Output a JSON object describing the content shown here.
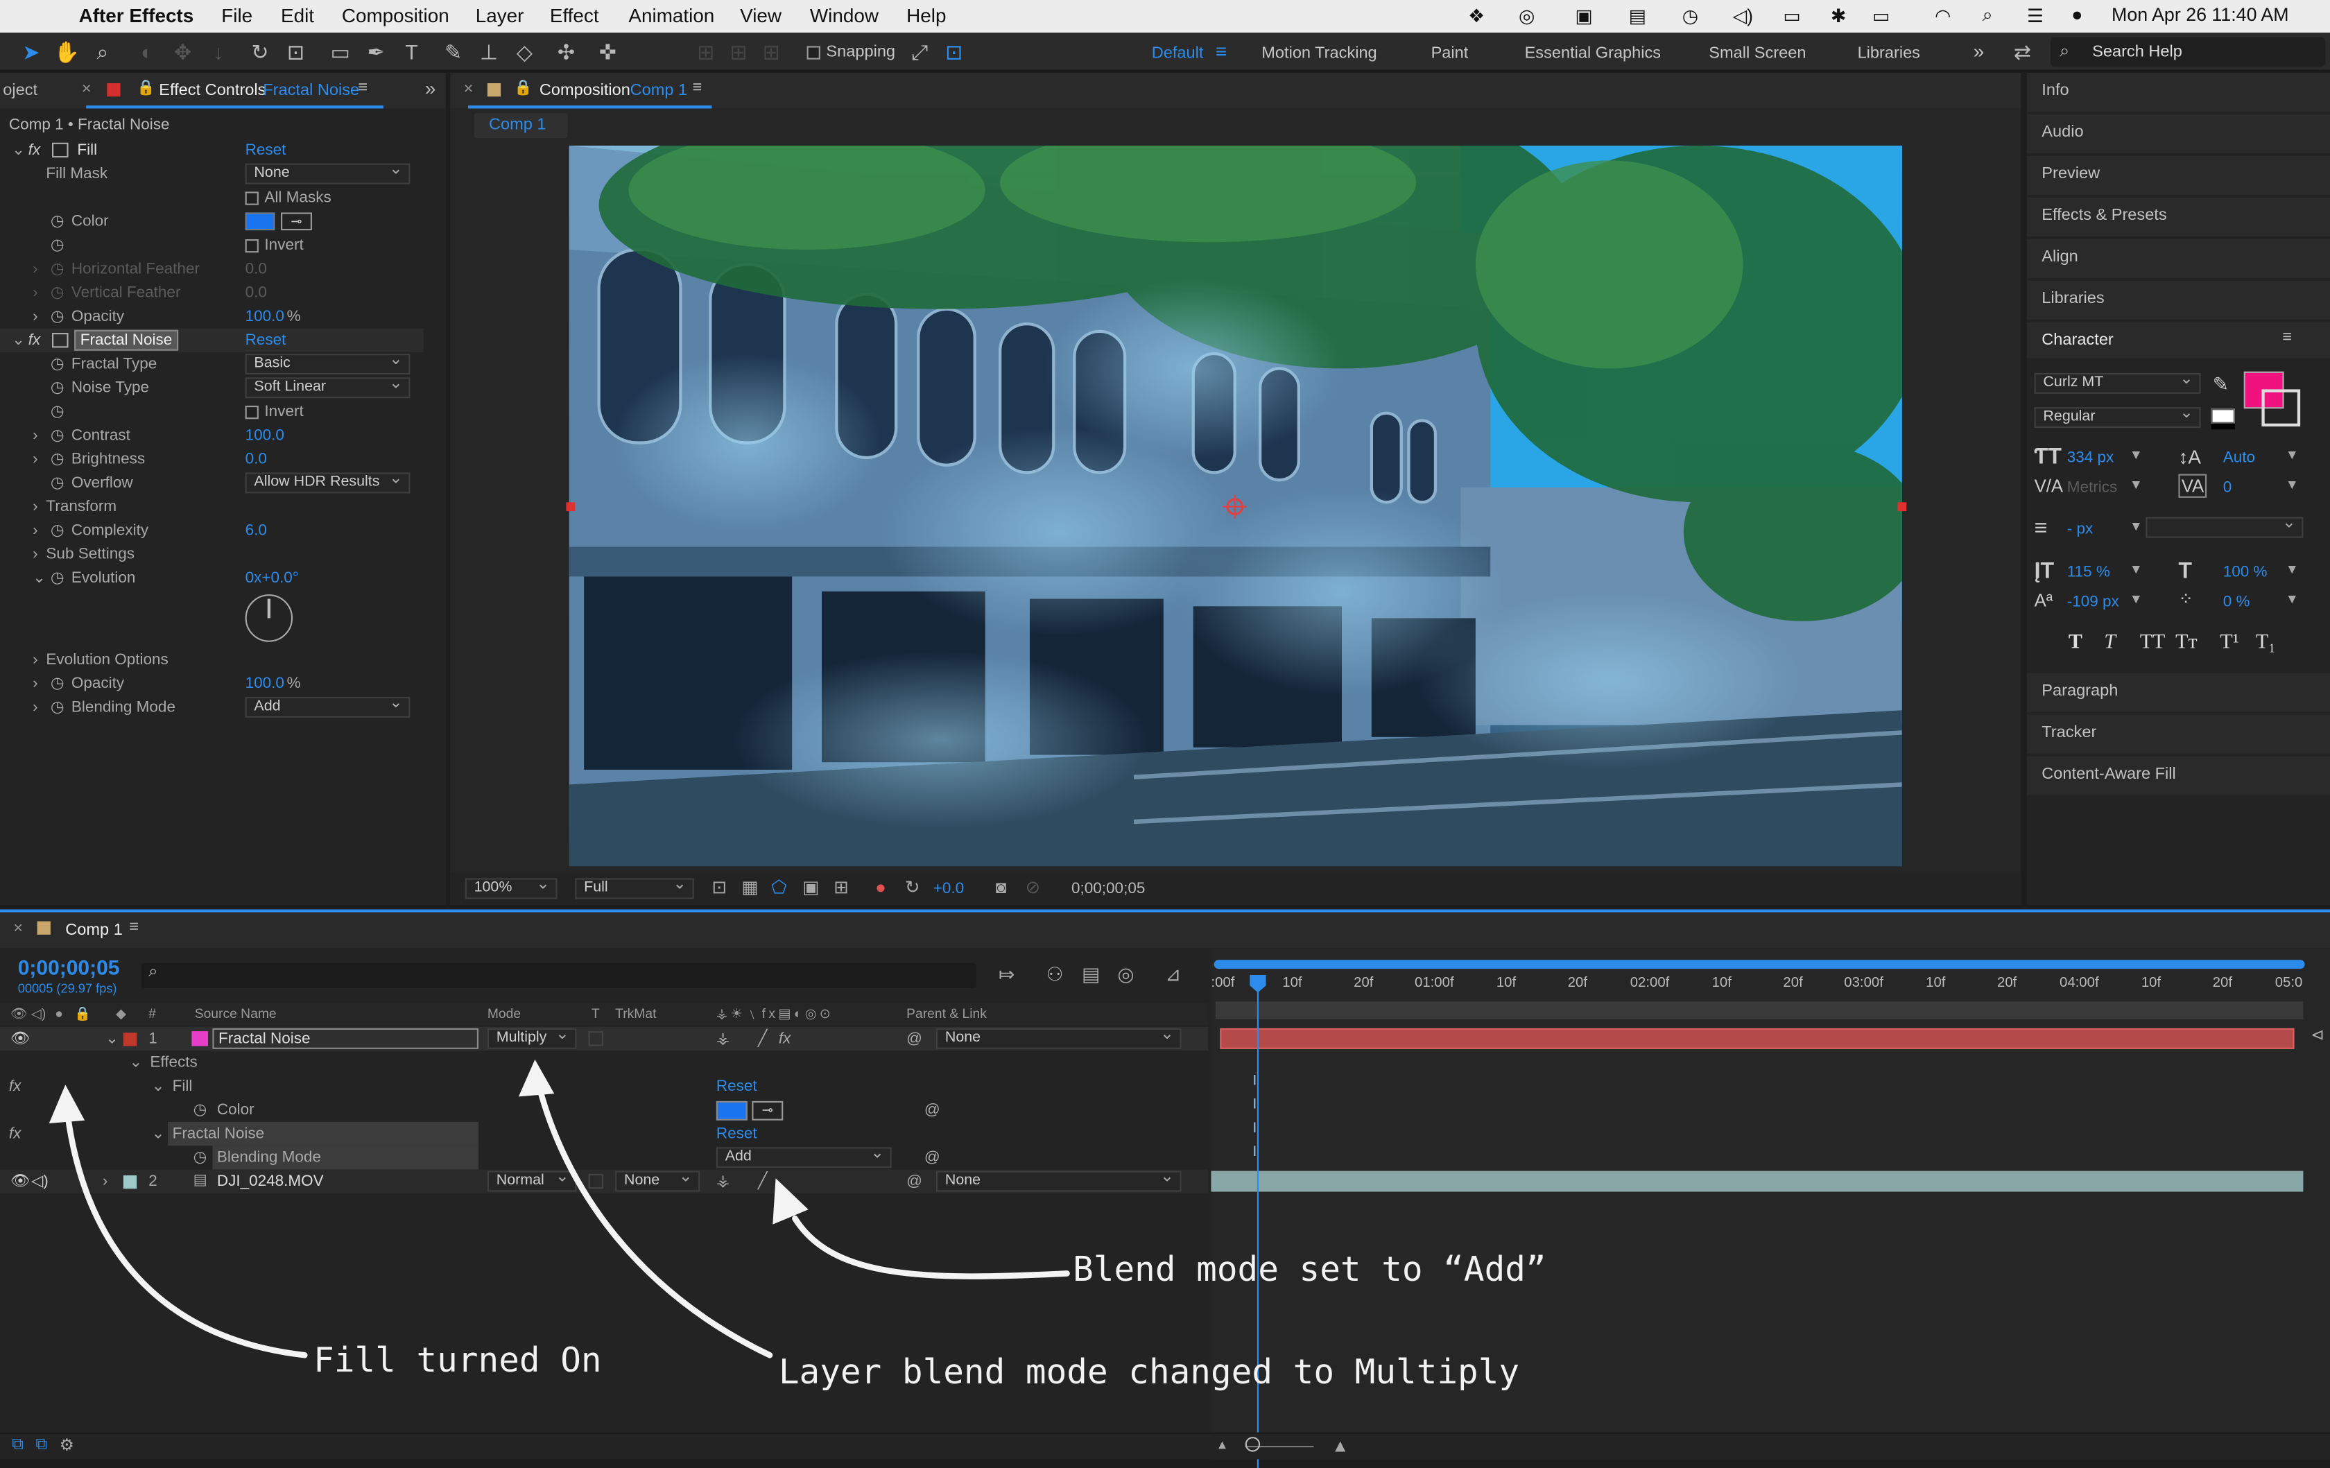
{
  "menubar": {
    "app": "After Effects",
    "items": [
      "File",
      "Edit",
      "Composition",
      "Layer",
      "Effect",
      "Animation",
      "View",
      "Window",
      "Help"
    ],
    "datetime": "Mon Apr 26  11:40 AM"
  },
  "toolbar": {
    "snapping": "Snapping",
    "workspaces": [
      "Default",
      "Motion Tracking",
      "Paint",
      "Essential Graphics",
      "Small Screen",
      "Libraries"
    ],
    "search": "Search Help"
  },
  "effect_controls": {
    "tab_project": "oject",
    "tab_label": "Effect Controls",
    "tab_layer": "Fractal Noise",
    "breadcrumb": "Comp 1 • Fractal Noise",
    "reset": "Reset",
    "fill": {
      "name": "Fill",
      "fill_mask_label": "Fill Mask",
      "fill_mask_value": "None",
      "all_masks": "All Masks",
      "color_label": "Color",
      "color_value": "#1a74f0",
      "invert": "Invert",
      "h_feather_label": "Horizontal Feather",
      "h_feather_value": "0.0",
      "v_feather_label": "Vertical Feather",
      "v_feather_value": "0.0",
      "opacity_label": "Opacity",
      "opacity_value": "100.0",
      "opacity_unit": "%"
    },
    "fractal": {
      "name": "Fractal Noise",
      "fractal_type_label": "Fractal Type",
      "fractal_type_value": "Basic",
      "noise_type_label": "Noise Type",
      "noise_type_value": "Soft Linear",
      "invert": "Invert",
      "contrast_label": "Contrast",
      "contrast_value": "100.0",
      "brightness_label": "Brightness",
      "brightness_value": "0.0",
      "overflow_label": "Overflow",
      "overflow_value": "Allow HDR Results",
      "transform": "Transform",
      "complexity_label": "Complexity",
      "complexity_value": "6.0",
      "sub_settings": "Sub Settings",
      "evolution_label": "Evolution",
      "evolution_value": "0x+0.0°",
      "evolution_options": "Evolution Options",
      "opacity_label": "Opacity",
      "opacity_value": "100.0",
      "opacity_unit": "%",
      "blending_label": "Blending Mode",
      "blending_value": "Add"
    }
  },
  "composition": {
    "tab_label": "Composition",
    "tab_comp": "Comp 1",
    "subtab": "Comp 1",
    "zoom": "100%",
    "resolution": "Full",
    "exposure": "+0.0",
    "timecode": "0;00;00;05"
  },
  "right_panel": {
    "items": [
      "Info",
      "Audio",
      "Preview",
      "Effects & Presets",
      "Align",
      "Libraries"
    ],
    "character_title": "Character",
    "font": "Curlz MT",
    "style": "Regular",
    "font_size": "334 px",
    "leading": "Auto",
    "kerning": "Metrics",
    "tracking": "0",
    "stroke": "- px",
    "v_scale": "115 %",
    "h_scale": "100 %",
    "baseline": "-109 px",
    "tsume": "0 %",
    "fill_color": "#f0127e",
    "type_buttons": [
      "T",
      "T",
      "TT",
      "Tт",
      "T¹",
      "T₁"
    ],
    "bottom_items": [
      "Paragraph",
      "Tracker",
      "Content-Aware Fill"
    ]
  },
  "timeline": {
    "tab": "Comp 1",
    "timecode": "0;00;00;05",
    "frames": "00005 (29.97 fps)",
    "headers": {
      "source": "Source Name",
      "mode": "Mode",
      "t": "T",
      "trkmat": "TrkMat",
      "parent": "Parent & Link"
    },
    "ruler": [
      ":00f",
      "10f",
      "20f",
      "01:00f",
      "10f",
      "20f",
      "02:00f",
      "10f",
      "20f",
      "03:00f",
      "10f",
      "20f",
      "04:00f",
      "10f",
      "20f",
      "05:0"
    ],
    "layer1": {
      "num": "1",
      "name": "Fractal Noise",
      "mode": "Multiply",
      "parent": "None",
      "label_color": "#e63ec8"
    },
    "effects_label": "Effects",
    "fill_label": "Fill",
    "reset": "Reset",
    "color_label": "Color",
    "fractal_label": "Fractal Noise",
    "blending_label": "Blending Mode",
    "blending_value": "Add",
    "layer2": {
      "num": "2",
      "name": "DJI_0248.MOV",
      "mode": "Normal",
      "trkmat": "None",
      "parent": "None",
      "label_color": "#9ec9c9"
    }
  },
  "annotations": {
    "blend": "Blend mode set to “Add”",
    "fill": "Fill turned On",
    "layer_blend": "Layer blend mode changed to Multiply"
  }
}
